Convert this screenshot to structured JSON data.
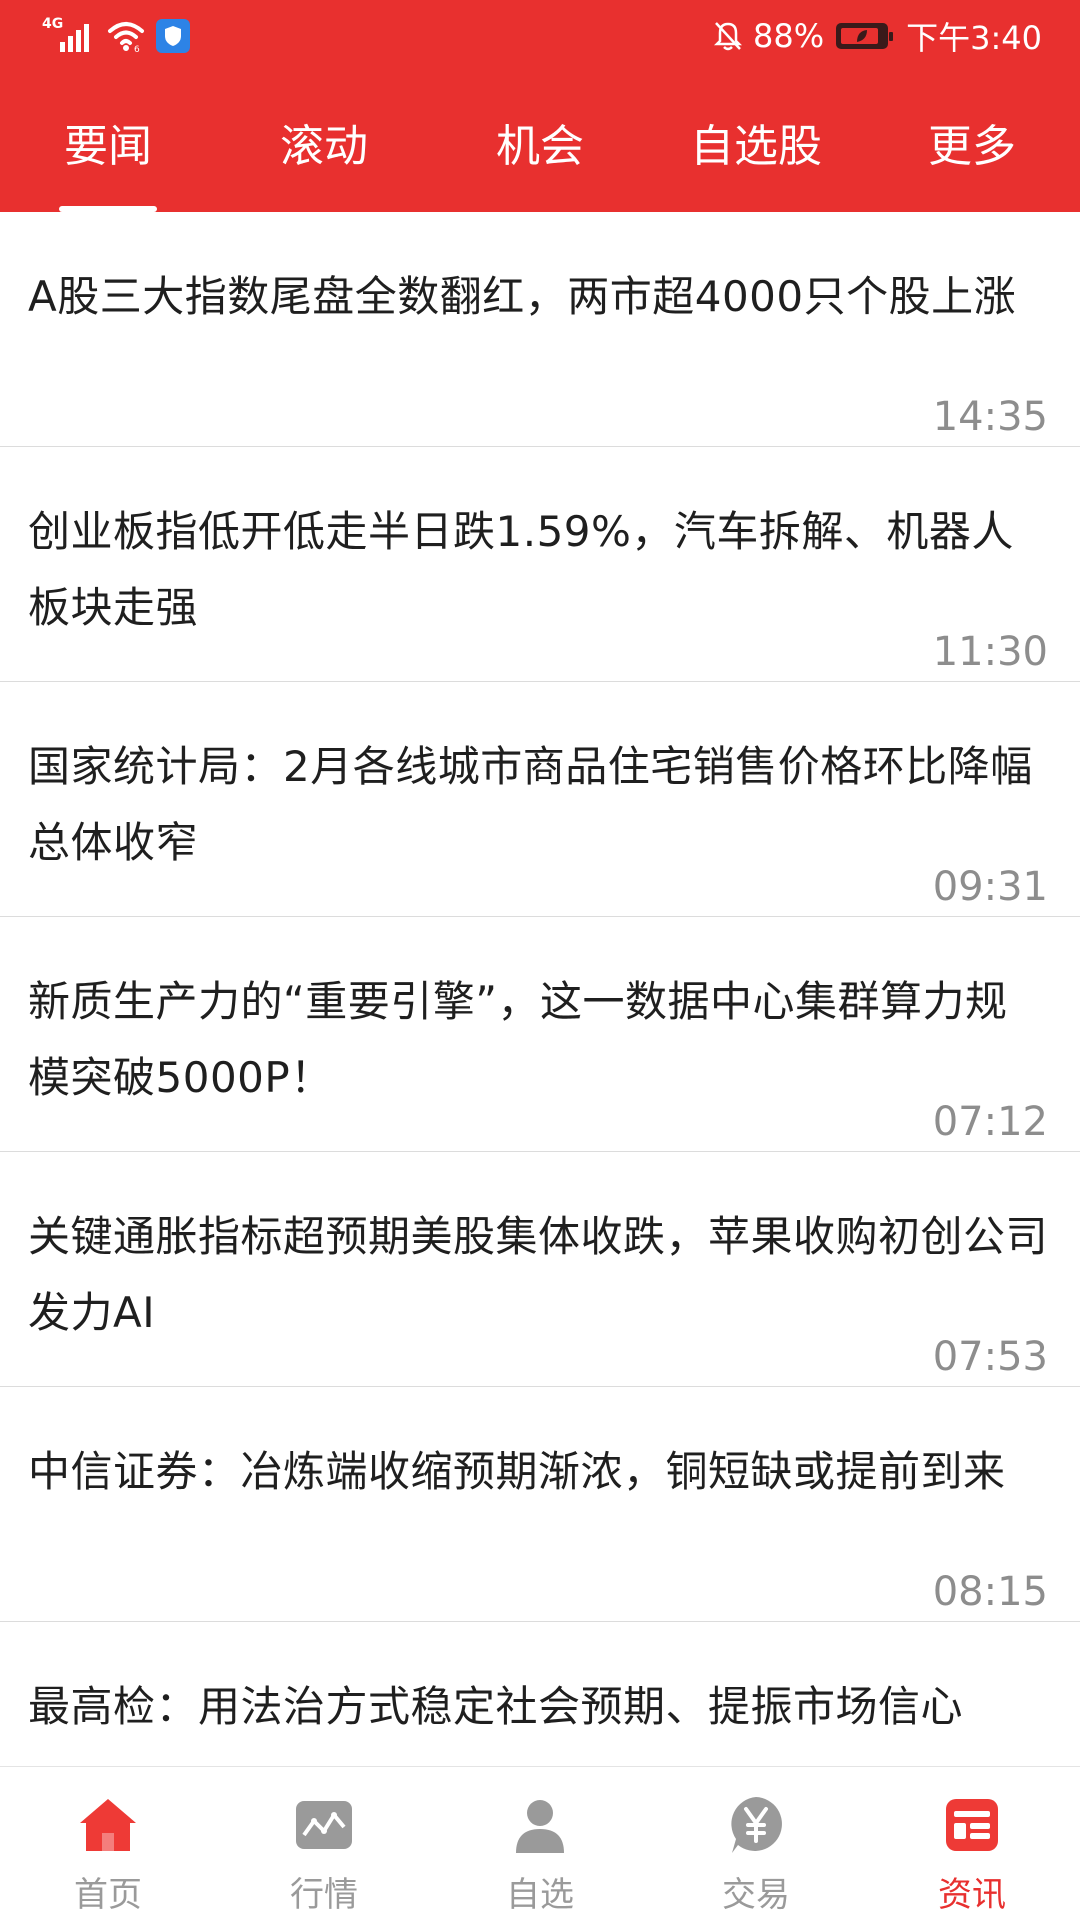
{
  "status_bar": {
    "network": "4G",
    "battery_percent": "88%",
    "battery_level": 0.88,
    "time": "下午3:40",
    "icons": [
      "signal-icon",
      "wifi-icon",
      "shield-app-icon",
      "bell-muted-icon",
      "battery-icon"
    ]
  },
  "tabs": [
    {
      "label": "要闻",
      "active": true
    },
    {
      "label": "滚动",
      "active": false
    },
    {
      "label": "机会",
      "active": false
    },
    {
      "label": "自选股",
      "active": false
    },
    {
      "label": "更多",
      "active": false
    }
  ],
  "news": [
    {
      "title": "A股三大指数尾盘全数翻红，两市超4000只个股上涨",
      "time": "14:35"
    },
    {
      "title": "创业板指低开低走半日跌1.59%，汽车拆解、机器人板块走强",
      "time": "11:30"
    },
    {
      "title": "国家统计局：2月各线城市商品住宅销售价格环比降幅总体收窄",
      "time": "09:31"
    },
    {
      "title": "新质生产力的“重要引擎”，这一数据中心集群算力规模突破5000P！",
      "time": "07:12"
    },
    {
      "title": "关键通胀指标超预期美股集体收跌，苹果收购初创公司发力AI",
      "time": "07:53"
    },
    {
      "title": "中信证券：冶炼端收缩预期渐浓，铜短缺或提前到来",
      "time": "08:15"
    },
    {
      "title": "最高检：用法治方式稳定社会预期、提振市场信心",
      "time": ""
    }
  ],
  "bottom_nav": [
    {
      "label": "首页",
      "icon": "home-icon",
      "active": false
    },
    {
      "label": "行情",
      "icon": "chart-icon",
      "active": false
    },
    {
      "label": "自选",
      "icon": "person-icon",
      "active": false
    },
    {
      "label": "交易",
      "icon": "yen-icon",
      "active": false
    },
    {
      "label": "资讯",
      "icon": "news-icon",
      "active": true
    }
  ],
  "colors": {
    "brand_red": "#e8302f",
    "title_text": "#1f1f1f",
    "time_text": "#8d8d8d",
    "nav_inactive": "#9a9a9a"
  }
}
